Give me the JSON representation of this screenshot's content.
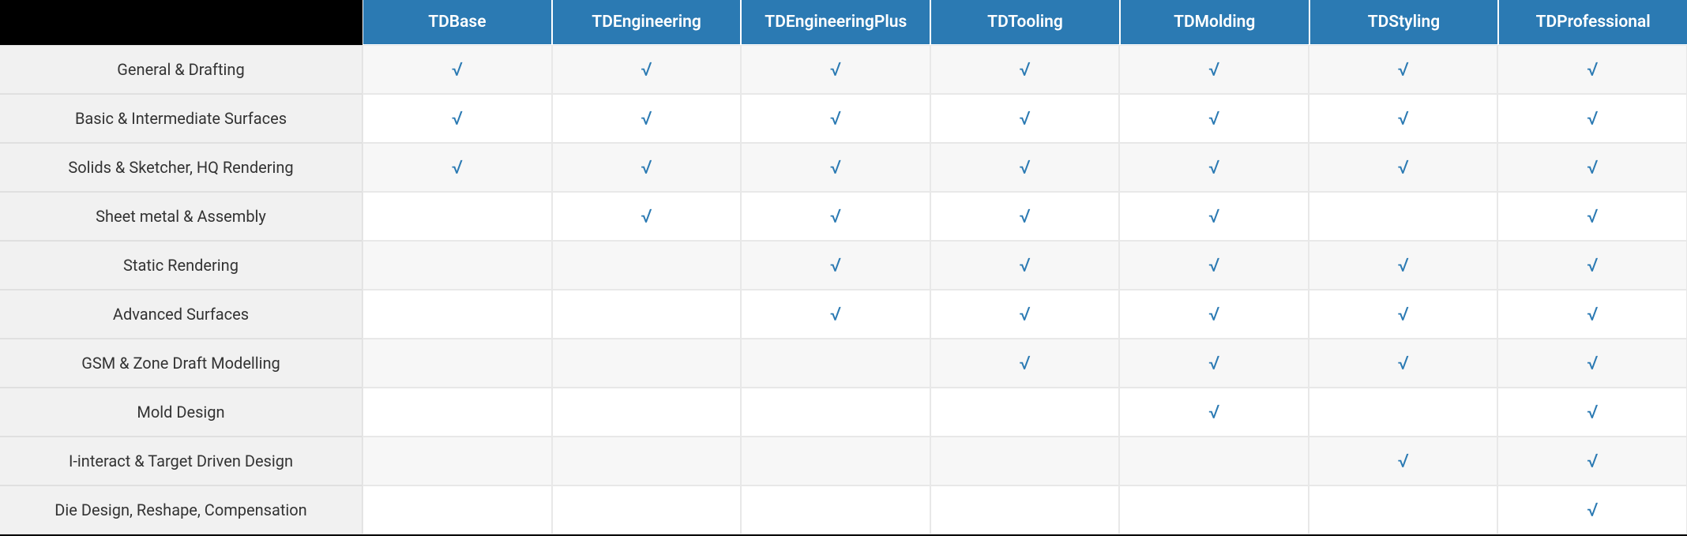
{
  "columns": [
    "TDBase",
    "TDEngineering",
    "TDEngineeringPlus",
    "TDTooling",
    "TDMolding",
    "TDStyling",
    "TDProfessional"
  ],
  "rows": [
    {
      "label": "General & Drafting",
      "values": [
        "√",
        "√",
        "√",
        "√",
        "√",
        "√",
        "√"
      ]
    },
    {
      "label": "Basic & Intermediate Surfaces",
      "values": [
        "√",
        "√",
        "√",
        "√",
        "√",
        "√",
        "√"
      ]
    },
    {
      "label": "Solids & Sketcher, HQ Rendering",
      "values": [
        "√",
        "√",
        "√",
        "√",
        "√",
        "√",
        "√"
      ]
    },
    {
      "label": "Sheet metal & Assembly",
      "values": [
        "",
        "√",
        "√",
        "√",
        "√",
        "",
        "√"
      ]
    },
    {
      "label": "Static Rendering",
      "values": [
        "",
        "",
        "√",
        "√",
        "√",
        "√",
        "√"
      ]
    },
    {
      "label": "Advanced Surfaces",
      "values": [
        "",
        "",
        "√",
        "√",
        "√",
        "√",
        "√"
      ]
    },
    {
      "label": "GSM & Zone Draft Modelling",
      "values": [
        "",
        "",
        "",
        "√",
        "√",
        "√",
        "√"
      ]
    },
    {
      "label": "Mold Design",
      "values": [
        "",
        "",
        "",
        "",
        "√",
        "",
        "√"
      ]
    },
    {
      "label": "I-interact & Target Driven Design",
      "values": [
        "",
        "",
        "",
        "",
        "",
        "√",
        "√"
      ]
    },
    {
      "label": "Die Design, Reshape, Compensation",
      "values": [
        "",
        "",
        "",
        "",
        "",
        "",
        "√"
      ]
    }
  ]
}
